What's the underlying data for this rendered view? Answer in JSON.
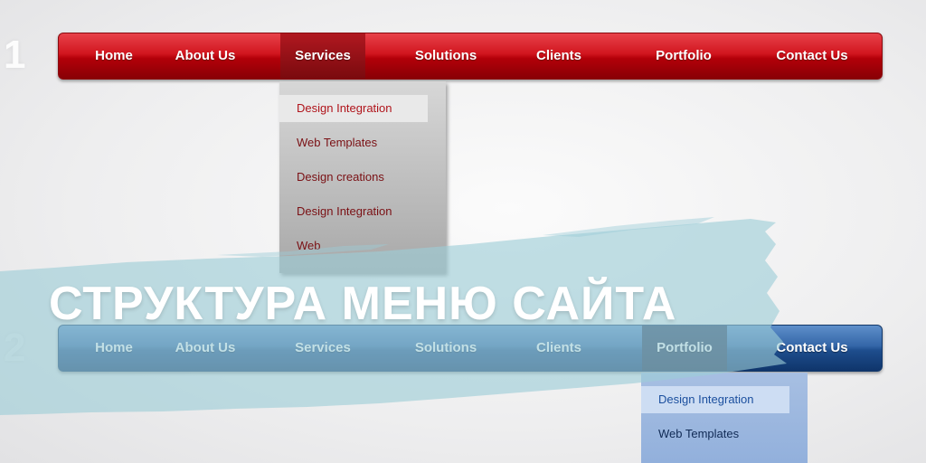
{
  "markers": {
    "first": "1",
    "second": "2"
  },
  "menu_top": {
    "items": [
      "Home",
      "About Us",
      "Services",
      "Solutions",
      "Clients",
      "Portfolio",
      "Contact Us"
    ],
    "active": "Services",
    "color": "#c80d15"
  },
  "dropdown_top": {
    "items": [
      "Design Integration",
      "Web Templates",
      "Design creations",
      "Design Integration",
      "Web"
    ],
    "highlighted": "Design Integration"
  },
  "menu_bottom": {
    "items": [
      "Home",
      "About Us",
      "Services",
      "Solutions",
      "Clients",
      "Portfolio",
      "Contact Us"
    ],
    "active": "Portfolio",
    "color": "#1e4d8d"
  },
  "dropdown_bottom": {
    "items": [
      "Design Integration",
      "Web Templates"
    ],
    "highlighted": "Design Integration"
  },
  "headline": "СТРУКТУРА МЕНЮ САЙТА",
  "overlay_color": "#9ccdd6"
}
